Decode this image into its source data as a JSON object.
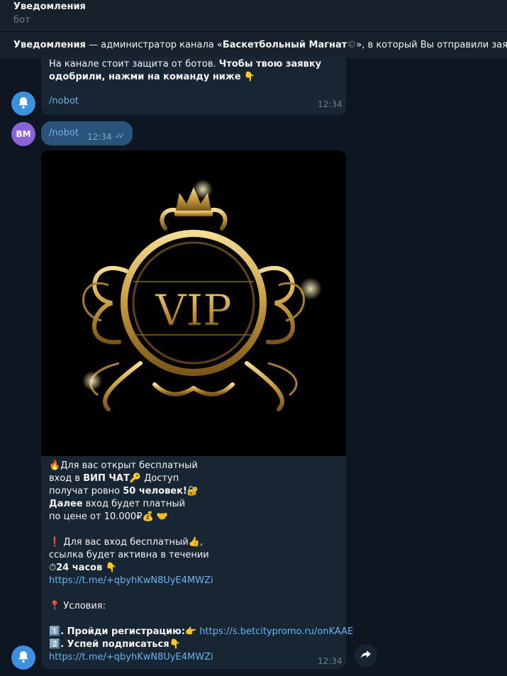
{
  "header": {
    "title": "Уведомления",
    "subtitle": "бот"
  },
  "notice": {
    "sender": "Уведомления",
    "text_1": " — администратор канала «",
    "channel": "Баскетбольный Магнат",
    "channel_mark": "©",
    "text_2": "», в который Вы отправили заявку."
  },
  "messages": {
    "first": {
      "text_plain": "На канале стоит защита от ботов. ",
      "text_bold_1": "Чтобы твою заявку",
      "text_bold_2": "одобрили, нажми на команду ниже",
      "emoji": "👇",
      "command": "/nobot",
      "time": "12:34"
    },
    "outgoing": {
      "avatar_initials": "BM",
      "text": "/nobot",
      "time": "12:34"
    },
    "vip": {
      "image_label": "VIP",
      "l1_emoji": "🔥",
      "l1": "Для вас открыт бесплатный",
      "l2_a": "вход в ",
      "l2_b": "ВИП ЧАТ",
      "l2_emoji": "🔑",
      "l2_c": " Доступ",
      "l3_a": "получат ровно ",
      "l3_b": "50 человек!",
      "l3_emoji": "🔐",
      "l4_a": "Далее",
      "l4_b": " вход будет платный",
      "l5_a": "по цене от 10.000₽",
      "l5_emoji": "💰 🤝",
      "l6_emoji": "❗",
      "l6": " Для вас вход бесплатный",
      "l6_emoji2": "👍",
      "l6_b": ",",
      "l7": " ссылка будет активна в течении",
      "l8_emoji": "⏱",
      "l8": "24 часов",
      "l8_emoji2": " 👇",
      "link1": "https://t.me/+qbyhKwN8UyE4MWZi",
      "l9_emoji": "📍",
      "l9": " Условия:",
      "l10_emoji": "1️⃣",
      "l10_a": ". Пройди регистрацию:",
      "l10_emoji2": "👉",
      "l10_link": " https://s.betcitypromo.ru/onKAAE",
      "l11_emoji": "2️⃣",
      "l11_a": ". Успей подписаться",
      "l11_emoji2": "👇",
      "link2": "https://t.me/+qbyhKwN8UyE4MWZi",
      "time": "12:34"
    }
  },
  "icons": {
    "bell": "bell-icon",
    "share": "share-icon",
    "read": "double-check-icon"
  },
  "colors": {
    "background": "#0e1621",
    "bubble_in": "#182533",
    "bubble_out": "#2b5278",
    "link": "#6ab3f3",
    "avatar_bot": "#3d8fe0",
    "avatar_user": "#8b63d8",
    "gold": "#d8b060"
  }
}
